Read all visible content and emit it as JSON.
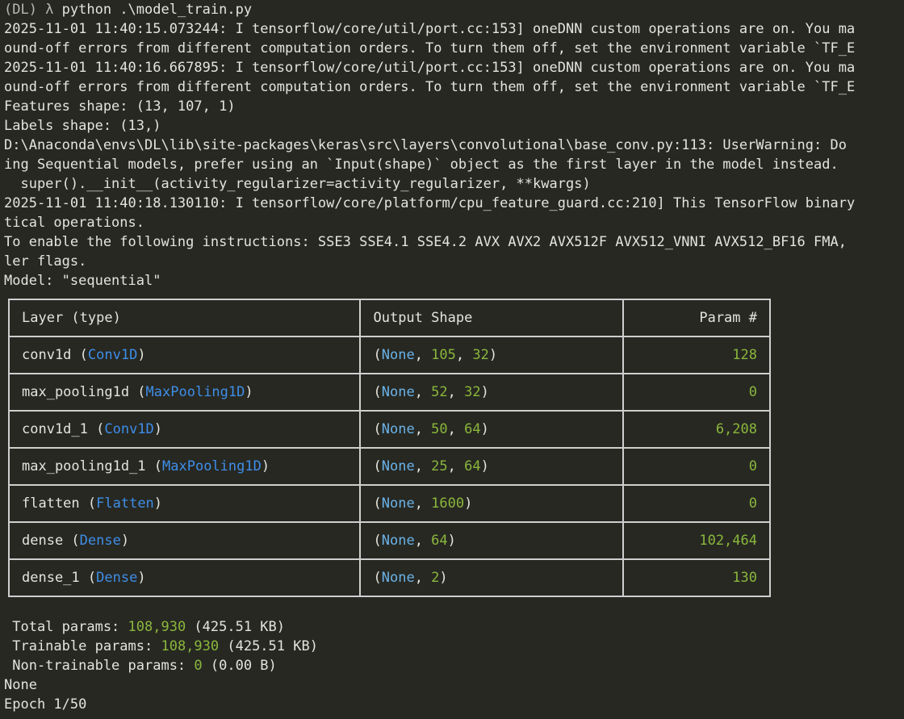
{
  "prompt": {
    "env": "(DL) λ",
    "command": "python .\\model_train.py"
  },
  "log_lines": [
    "2025-11-01 11:40:15.073244: I tensorflow/core/util/port.cc:153] oneDNN custom operations are on. You ma",
    "ound-off errors from different computation orders. To turn them off, set the environment variable `TF_E",
    "2025-11-01 11:40:16.667895: I tensorflow/core/util/port.cc:153] oneDNN custom operations are on. You ma",
    "ound-off errors from different computation orders. To turn them off, set the environment variable `TF_E",
    "Features shape: (13, 107, 1)",
    "Labels shape: (13,)",
    "D:\\Anaconda\\envs\\DL\\lib\\site-packages\\keras\\src\\layers\\convolutional\\base_conv.py:113: UserWarning: Do",
    "ing Sequential models, prefer using an `Input(shape)` object as the first layer in the model instead.",
    "  super().__init__(activity_regularizer=activity_regularizer, **kwargs)",
    "2025-11-01 11:40:18.130110: I tensorflow/core/platform/cpu_feature_guard.cc:210] This TensorFlow binary",
    "tical operations.",
    "To enable the following instructions: SSE3 SSE4.1 SSE4.2 AVX AVX2 AVX512F AVX512_VNNI AVX512_BF16 FMA,",
    "ler flags.",
    "Model: \"sequential\""
  ],
  "table": {
    "headers": {
      "layer": "Layer (type)",
      "shape": "Output Shape",
      "param": "Param #"
    },
    "rows": [
      {
        "name": "conv1d",
        "type": "Conv1D",
        "shape_prefix": "None",
        "dims": [
          "105",
          "32"
        ],
        "params": "128"
      },
      {
        "name": "max_pooling1d",
        "type": "MaxPooling1D",
        "shape_prefix": "None",
        "dims": [
          "52",
          "32"
        ],
        "params": "0"
      },
      {
        "name": "conv1d_1",
        "type": "Conv1D",
        "shape_prefix": "None",
        "dims": [
          "50",
          "64"
        ],
        "params": "6,208"
      },
      {
        "name": "max_pooling1d_1",
        "type": "MaxPooling1D",
        "shape_prefix": "None",
        "dims": [
          "25",
          "64"
        ],
        "params": "0"
      },
      {
        "name": "flatten",
        "type": "Flatten",
        "shape_prefix": "None",
        "dims": [
          "1600"
        ],
        "params": "0"
      },
      {
        "name": "dense",
        "type": "Dense",
        "shape_prefix": "None",
        "dims": [
          "64"
        ],
        "params": "102,464"
      },
      {
        "name": "dense_1",
        "type": "Dense",
        "shape_prefix": "None",
        "dims": [
          "2"
        ],
        "params": "130"
      }
    ]
  },
  "totals": {
    "total_label": " Total params: ",
    "total_value": "108,930",
    "total_size": " (425.51 KB)",
    "trainable_label": " Trainable params: ",
    "trainable_value": "108,930",
    "trainable_size": " (425.51 KB)",
    "nontrainable_label": " Non-trainable params: ",
    "nontrainable_value": "0",
    "nontrainable_size": " (0.00 B)"
  },
  "after_lines": [
    "None",
    "Epoch 1/50"
  ],
  "colors": {
    "background": "#272822",
    "text": "#e4e4dc",
    "type_blue": "#3e8ee8",
    "none_cyan": "#6ab2e8",
    "number_green": "#8ab73c",
    "border": "#cfcfcf"
  }
}
